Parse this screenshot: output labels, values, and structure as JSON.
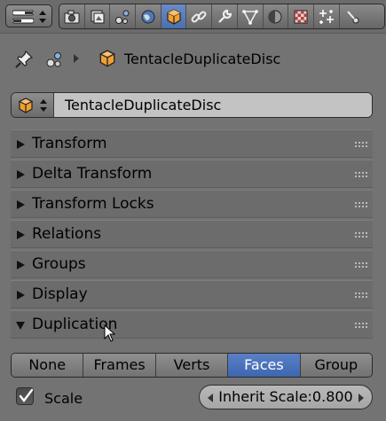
{
  "header": {
    "editor_type_icon": "editor-type-menu-icon",
    "tabs": [
      {
        "name": "render-icon",
        "active": false
      },
      {
        "name": "render-layers-icon",
        "active": false
      },
      {
        "name": "scene-icon",
        "active": false
      },
      {
        "name": "world-icon",
        "active": false
      },
      {
        "name": "object-icon",
        "active": true
      },
      {
        "name": "constraints-icon",
        "active": false
      },
      {
        "name": "modifiers-icon",
        "active": false
      },
      {
        "name": "object-data-icon",
        "active": false
      },
      {
        "name": "material-icon",
        "active": false
      },
      {
        "name": "texture-icon",
        "active": false
      },
      {
        "name": "particles-icon",
        "active": false
      },
      {
        "name": "physics-icon",
        "active": false
      }
    ]
  },
  "context": {
    "object_name": "TentacleDuplicateDisc"
  },
  "object_field": {
    "value": "TentacleDuplicateDisc"
  },
  "panels": [
    {
      "title": "Transform",
      "expanded": false
    },
    {
      "title": "Delta Transform",
      "expanded": false
    },
    {
      "title": "Transform Locks",
      "expanded": false
    },
    {
      "title": "Relations",
      "expanded": false
    },
    {
      "title": "Groups",
      "expanded": false
    },
    {
      "title": "Display",
      "expanded": false
    },
    {
      "title": "Duplication",
      "expanded": true
    }
  ],
  "duplication": {
    "options": [
      "None",
      "Frames",
      "Verts",
      "Faces",
      "Group"
    ],
    "selected": "Faces",
    "scale_label": "Scale",
    "scale_checked": true,
    "inherit_scale": "Inherit Scale:0.800"
  },
  "colors": {
    "background": "#737373",
    "active_accent": "#4a6fb0",
    "object_icon": "#f0a030"
  }
}
